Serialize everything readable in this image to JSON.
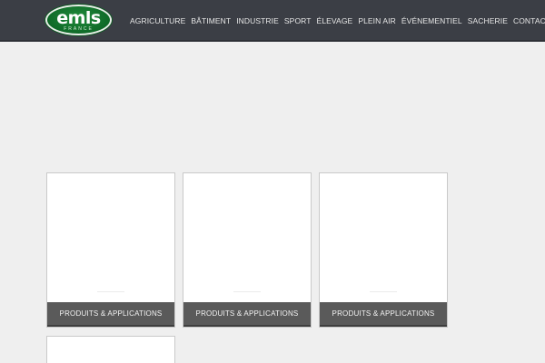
{
  "header": {
    "logo": {
      "text": "emls",
      "subtext": "FRANCE"
    },
    "nav": [
      "AGRICULTURE",
      "BÂTIMENT",
      "INDUSTRIE",
      "SPORT",
      "ÉLEVAGE",
      "PLEIN AIR",
      "ÉVÉNEMENTIEL",
      "SACHERIE",
      "CONTACT"
    ]
  },
  "cards": [
    {
      "label": "PRODUITS & APPLICATIONS"
    },
    {
      "label": "PRODUITS & APPLICATIONS"
    },
    {
      "label": "PRODUITS & APPLICATIONS"
    }
  ]
}
